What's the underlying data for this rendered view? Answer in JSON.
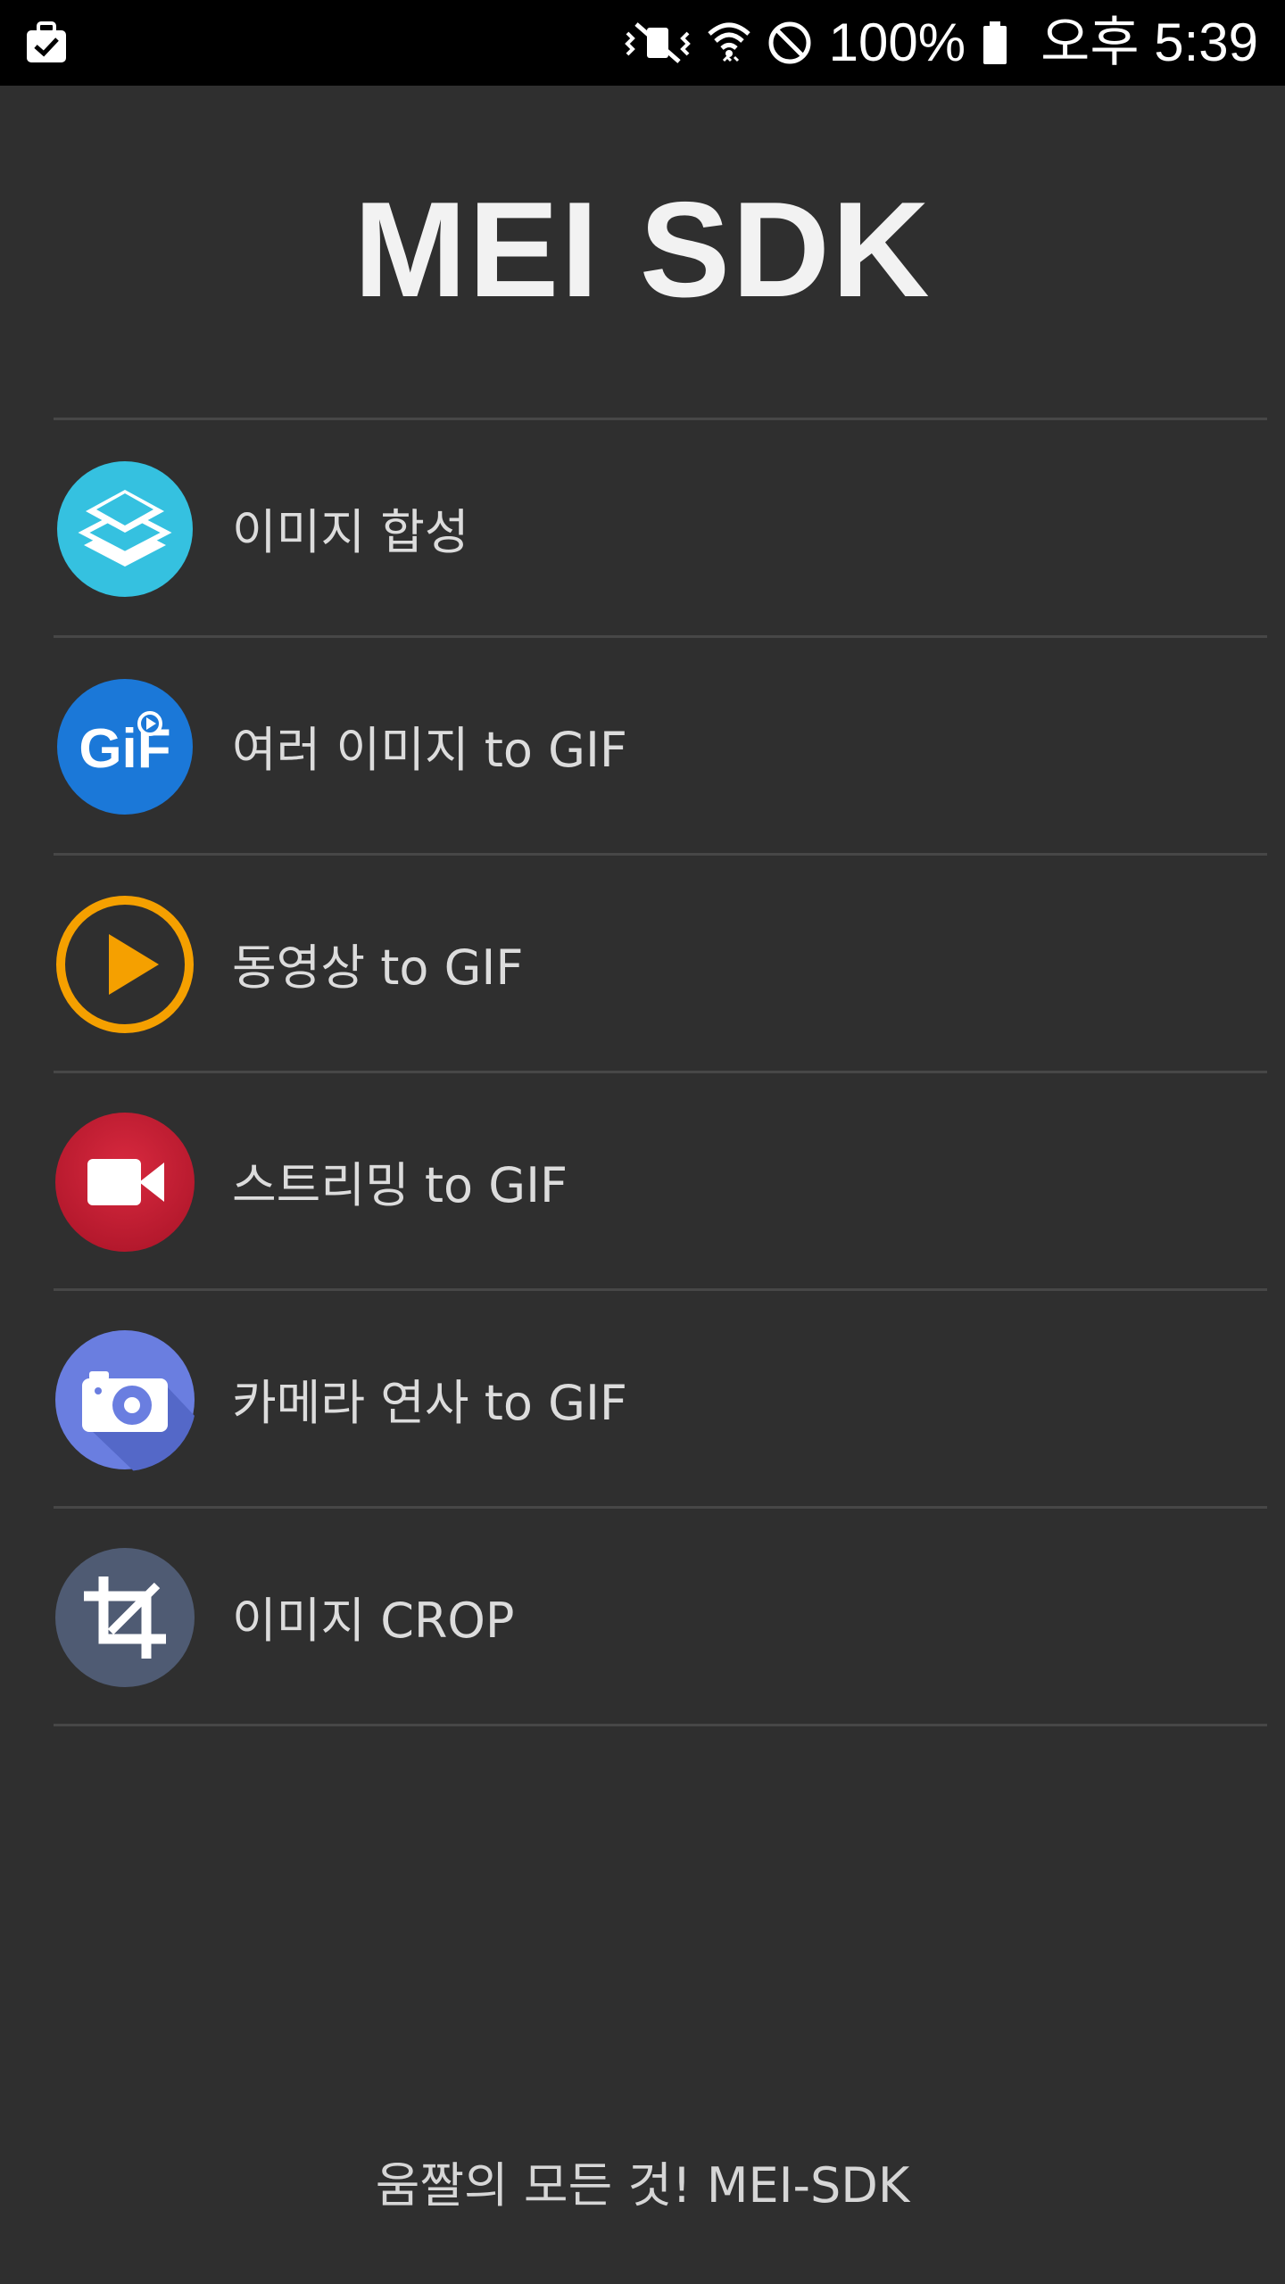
{
  "status_bar": {
    "battery": "100%",
    "time": "오후 5:39",
    "icons": [
      "briefcase-check-icon",
      "vibrate-mute-icon",
      "wifi-icon",
      "block-icon",
      "battery-icon"
    ]
  },
  "header": {
    "title": "MEI SDK"
  },
  "menu": {
    "items": [
      {
        "label": "이미지 합성",
        "icon": "layers-icon",
        "color": "#35c1e0"
      },
      {
        "label": "여러 이미지 to GIF",
        "icon": "gif-icon",
        "color": "#1b78d8"
      },
      {
        "label": "동영상 to GIF",
        "icon": "play-icon",
        "color": "#f5a000"
      },
      {
        "label": "스트리밍 to GIF",
        "icon": "video-camera-icon",
        "color": "#c71f36"
      },
      {
        "label": "카메라 연사 to GIF",
        "icon": "camera-icon",
        "color": "#6a7ee0"
      },
      {
        "label": "이미지 CROP",
        "icon": "crop-icon",
        "color": "#4f5b73"
      }
    ]
  },
  "footer": {
    "text": "움짤의 모든 것! MEI-SDK"
  },
  "gif_badge_text": "GiF"
}
